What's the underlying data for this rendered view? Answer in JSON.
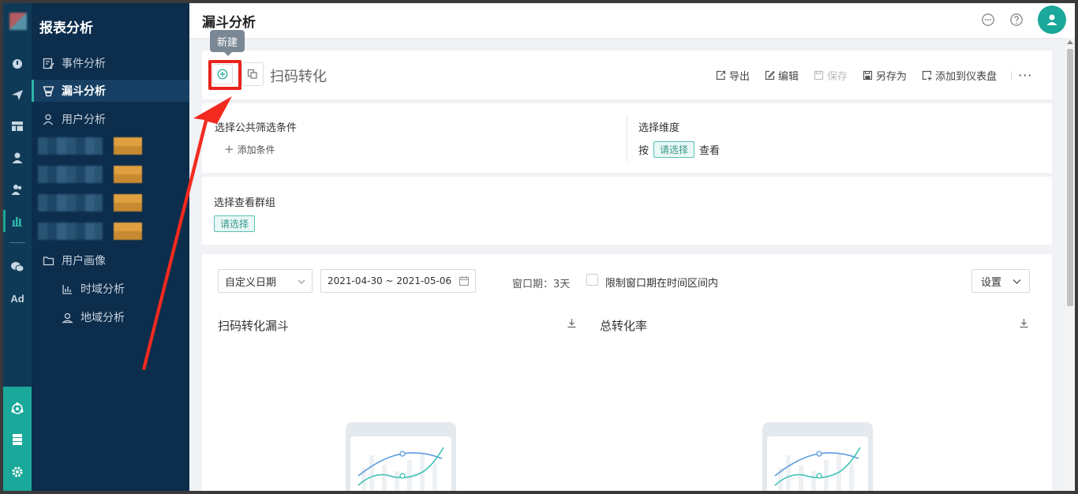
{
  "header": {
    "page_title": "漏斗分析"
  },
  "nav": {
    "title": "报表分析",
    "items": [
      {
        "label": "事件分析"
      },
      {
        "label": "漏斗分析"
      },
      {
        "label": "用户分析"
      },
      {
        "label": "用户画像"
      },
      {
        "label": "时域分析"
      },
      {
        "label": "地域分析"
      }
    ]
  },
  "rail": {
    "ad_label": "Ad"
  },
  "tooltip": {
    "text": "新建"
  },
  "toolbar": {
    "report_name": "扫码转化",
    "export_label": "导出",
    "edit_label": "编辑",
    "save_label": "保存",
    "save_as_label": "另存为",
    "add_dashboard_label": "添加到仪表盘",
    "more_label": "···"
  },
  "filters": {
    "public_filter_label": "选择公共筛选条件",
    "add_condition_label": "添加条件",
    "dimension_label": "选择维度",
    "by_label": "按",
    "select_tag": "请选择",
    "view_label": "查看",
    "group_label": "选择查看群组",
    "group_select_tag": "请选择"
  },
  "main": {
    "date_mode": "自定义日期",
    "date_range": "2021-04-30 ~ 2021-05-06",
    "window_label": "窗口期：3天",
    "limit_window_label": "限制窗口期在时间区间内",
    "settings_label": "设置",
    "funnel_chart_title": "扫码转化漏斗",
    "conversion_chart_title": "总转化率"
  },
  "colors": {
    "accent": "#1aa89a",
    "nav_bg": "#0c2d4c",
    "highlight": "#e8231d"
  }
}
